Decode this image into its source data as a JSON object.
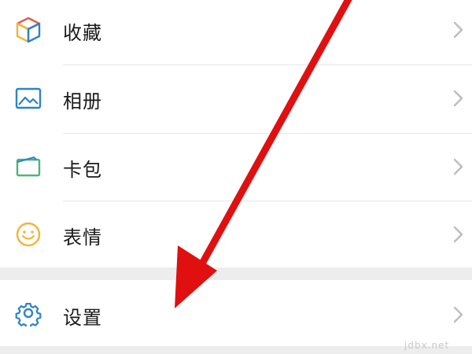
{
  "menu": {
    "items": [
      {
        "label": "收藏",
        "icon": "cube-icon"
      },
      {
        "label": "相册",
        "icon": "picture-icon"
      },
      {
        "label": "卡包",
        "icon": "wallet-card-icon"
      },
      {
        "label": "表情",
        "icon": "smiley-icon"
      }
    ],
    "settings": {
      "label": "设置",
      "icon": "gear-icon"
    }
  },
  "colors": {
    "icon_blue": "#2f83c4",
    "icon_yellow": "#f2b53a",
    "icon_red": "#e25b4a",
    "icon_green": "#4fb37a",
    "arrow_red": "#e01010",
    "separator": "#ededed"
  },
  "watermark": "jdbx.net"
}
